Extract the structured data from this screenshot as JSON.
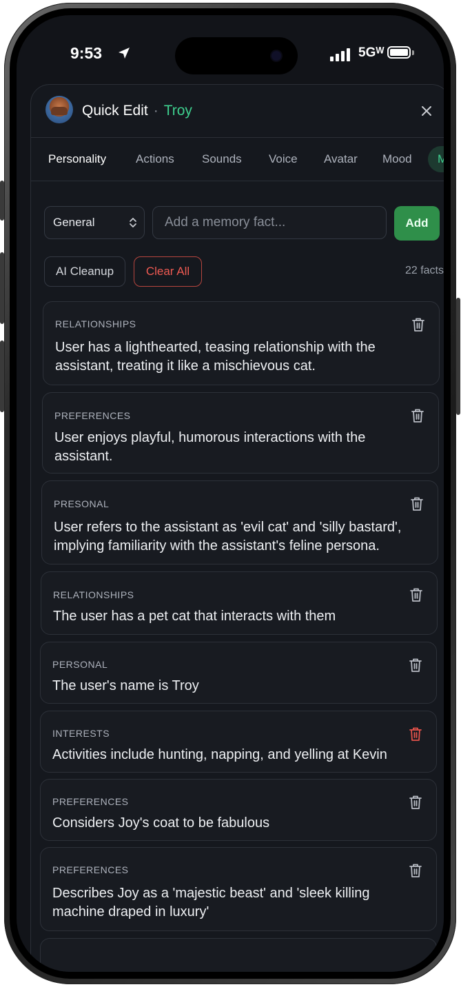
{
  "status_bar": {
    "time": "9:53",
    "network": "5Gᵂ"
  },
  "header": {
    "title": "Quick Edit",
    "separator": "·",
    "character_name": "Troy"
  },
  "tabs": [
    {
      "label": "Personality",
      "active": true
    },
    {
      "label": "Actions"
    },
    {
      "label": "Sounds"
    },
    {
      "label": "Voice"
    },
    {
      "label": "Avatar"
    },
    {
      "label": "Mood"
    },
    {
      "label": "Me"
    }
  ],
  "controls": {
    "category_select": "General",
    "fact_input_placeholder": "Add a memory fact...",
    "add_label": "Add",
    "ai_cleanup_label": "AI Cleanup",
    "clear_all_label": "Clear All",
    "fact_count": "22 facts"
  },
  "facts": [
    {
      "category": "RELATIONSHIPS",
      "text": "User has a lighthearted, teasing relationship with the assistant, treating it like a mischievous cat."
    },
    {
      "category": "PREFERENCES",
      "text": "User enjoys playful, humorous interactions with the assistant."
    },
    {
      "category": "PRESONAL",
      "text": "User refers to the assistant as 'evil cat' and 'silly bastard', implying familiarity with the assistant's feline persona."
    },
    {
      "category": "RELATIONSHIPS",
      "text": "The user has a pet cat that interacts with them"
    },
    {
      "category": "PERSONAL",
      "text": "The user's name is Troy"
    },
    {
      "category": "INTERESTS",
      "text": "Activities include hunting, napping, and yelling at Kevin",
      "trash_highlighted": true
    },
    {
      "category": "PREFERENCES",
      "text": "Considers Joy's coat to be fabulous"
    },
    {
      "category": "PREFERENCES",
      "text": "Describes Joy as a 'majestic beast' and 'sleek killing machine draped in luxury'"
    }
  ],
  "colors": {
    "accent_green": "#3ecf8e",
    "add_button": "#2f8f4a",
    "danger_red": "#ef5a52",
    "background": "#15181e"
  }
}
